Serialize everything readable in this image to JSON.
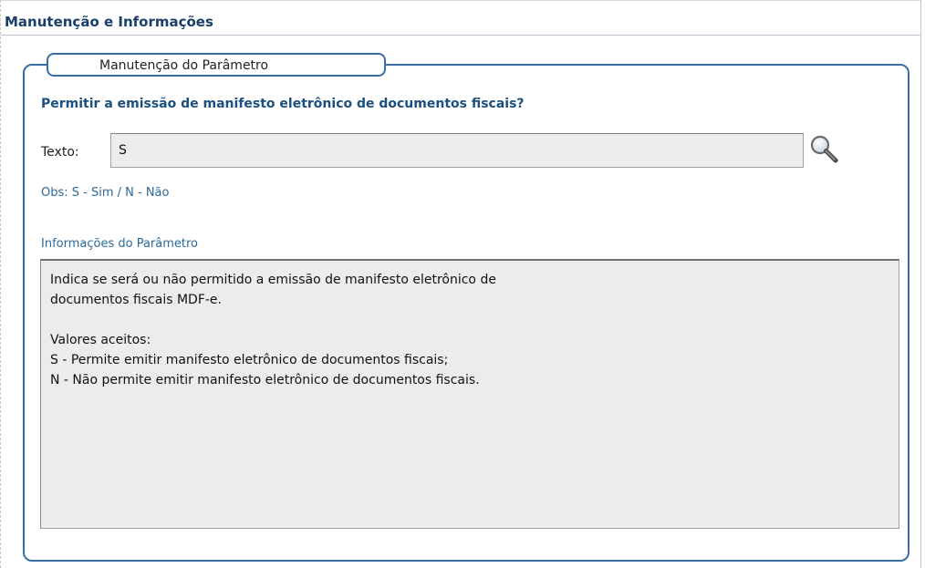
{
  "header": {
    "title": "Manutenção e Informações"
  },
  "fieldset": {
    "legend": "Manutenção do Parâmetro",
    "question": "Permitir a emissão de manifesto eletrônico de documentos fiscais?",
    "texto_label": "Texto:",
    "texto_value": "S",
    "search_icon": "magnifier-icon",
    "obs": "Obs: S - Sim / N - Não",
    "info_label": "Informações do Parâmetro",
    "info_lines": [
      "Indica se será ou não permitido a emissão de manifesto eletrônico de",
      "documentos fiscais MDF-e.",
      "",
      "Valores aceitos:",
      "S - Permite emitir manifesto eletrônico de documentos fiscais;",
      "N - Não permite emitir manifesto eletrônico de documentos fiscais."
    ]
  },
  "colors": {
    "accent": "#3b6ea5",
    "title": "#1a3f6b",
    "label": "#2a6a9a",
    "field_bg": "#ececec"
  }
}
